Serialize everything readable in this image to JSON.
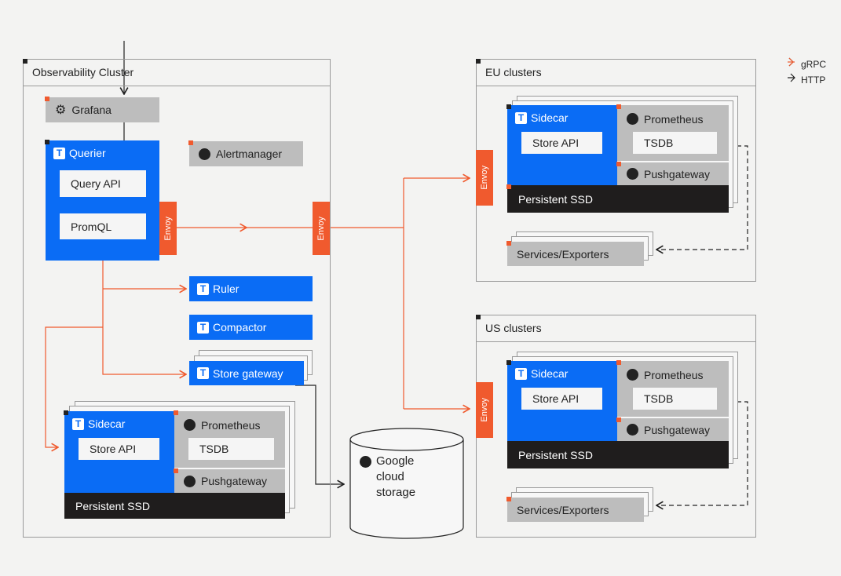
{
  "legend": {
    "grpc": "gRPC",
    "http": "HTTP"
  },
  "colors": {
    "grpc": "#f05a2e",
    "http": "#222222",
    "thanos": "#0a6cf5",
    "external": "#bdbdbd",
    "storage": "#1f1d1d"
  },
  "observability": {
    "title": "Observability Cluster",
    "grafana": "Grafana",
    "querier": "Querier",
    "query_api": "Query API",
    "promql": "PromQL",
    "alertmanager": "Alertmanager",
    "ruler": "Ruler",
    "compactor": "Compactor",
    "store_gateway": "Store gateway",
    "envoy": "Envoy",
    "sidecar": {
      "title": "Sidecar",
      "store_api": "Store API",
      "prometheus": "Prometheus",
      "tsdb": "TSDB",
      "pushgateway": "Pushgateway",
      "ssd": "Persistent SSD"
    }
  },
  "storage": {
    "gcs": "Google cloud storage"
  },
  "eu": {
    "title": "EU clusters",
    "envoy": "Envoy",
    "sidecar": "Sidecar",
    "store_api": "Store API",
    "prometheus": "Prometheus",
    "tsdb": "TSDB",
    "pushgateway": "Pushgateway",
    "ssd": "Persistent SSD",
    "services": "Services/Exporters"
  },
  "us": {
    "title": "US clusters",
    "envoy": "Envoy",
    "sidecar": "Sidecar",
    "store_api": "Store API",
    "prometheus": "Prometheus",
    "tsdb": "TSDB",
    "pushgateway": "Pushgateway",
    "ssd": "Persistent SSD",
    "services": "Services/Exporters"
  }
}
